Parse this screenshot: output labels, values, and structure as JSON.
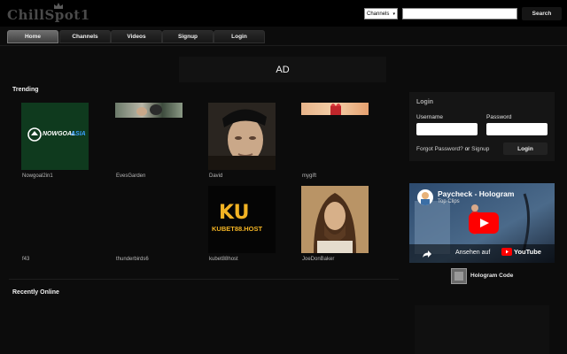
{
  "header": {
    "logo_text": "ChillSpot1",
    "channel_select_value": "Channels",
    "search_value": "",
    "search_button": "Search"
  },
  "nav": {
    "tabs": [
      {
        "label": "Home",
        "active": true
      },
      {
        "label": "Channels",
        "active": false
      },
      {
        "label": "Videos",
        "active": false
      },
      {
        "label": "Signup",
        "active": false
      },
      {
        "label": "Login",
        "active": false
      }
    ]
  },
  "ad": {
    "label": "AD"
  },
  "trending": {
    "title": "Trending",
    "items": [
      {
        "name": "Nowgoal2in1"
      },
      {
        "name": "EvesGarden"
      },
      {
        "name": "David"
      },
      {
        "name": "mygift"
      },
      {
        "name": "f43"
      },
      {
        "name": "thunderbirds6"
      },
      {
        "name": "kubet88host"
      },
      {
        "name": "JoeDonBaker"
      }
    ],
    "nowgoal_logo_text": "NOWGOAL",
    "nowgoal_logo_suffix": "ASIA",
    "kubet_logo_text": "KU",
    "kubet_host_text": "KUBET88.HOST"
  },
  "recently_online": {
    "title": "Recently Online"
  },
  "login": {
    "title": "Login",
    "username_label": "Username",
    "password_label": "Password",
    "username_value": "",
    "password_value": "",
    "forgot_text": "Forgot Password?",
    "or_text": "or",
    "signup_link": "Signup",
    "login_button": "Login"
  },
  "video": {
    "title": "Paycheck - Hologram",
    "channel": "Top Clips",
    "watch_on": "Ansehen auf",
    "platform": "YouTube"
  },
  "hologram": {
    "label": "Hologram Code"
  },
  "colors": {
    "background": "#0c0c0c",
    "panel": "#151515",
    "youtube_red": "#ff0000",
    "nowgoal_green": "#0f3a1e"
  }
}
